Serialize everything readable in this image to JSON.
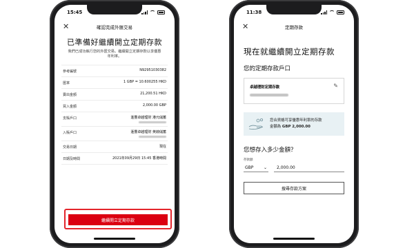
{
  "left": {
    "time": "15:45",
    "nav_title": "確認完成外匯交易",
    "headline": "已準備好繼續開立定期存款",
    "subline": "我們已成功執行您的外匯交易。繼續開立定期存款以享優惠年利率。",
    "rows": [
      {
        "label": "參考編號",
        "value": "N92951030382"
      },
      {
        "label": "匯率",
        "value": "1 GBP = 10.600255 HKD"
      },
      {
        "label": "賣出金額",
        "value": "21,200.51 HKD"
      },
      {
        "label": "買入金額",
        "value": "2,000.00 GBP"
      },
      {
        "label": "支賬戶口",
        "value": "滙豐卓越理財 港元儲蓄"
      },
      {
        "label": "入賬戶口",
        "value": "滙豐卓越理財 英鎊儲蓄"
      },
      {
        "label": "交易日期",
        "value": "現在"
      },
      {
        "label": "日期及時間",
        "value": "2021年09月29日 15:45 香港時間"
      }
    ],
    "cta": "繼續開立定期存款"
  },
  "right": {
    "time": "11:38",
    "nav_title": "定期存款",
    "headline": "現在就繼續開立定期存款",
    "section": "您的定期存款戶口",
    "card_title": "卓越理財定期存款",
    "promo_line1": "您合資格可享優惠年利率的存款",
    "promo_prefix": "金額為",
    "promo_amount": "GBP 2,000.00",
    "question": "您想存入多少金額？",
    "input_label": "存款額",
    "currency": "GBP",
    "amount": "2,000.00",
    "button": "搜尋存款方案"
  }
}
